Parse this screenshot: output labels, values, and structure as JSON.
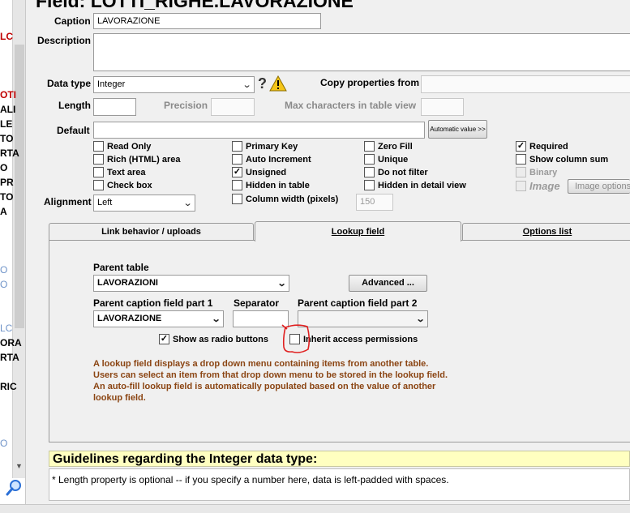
{
  "window_title": "Field: LOTTI_RIGHE.LAVORAZIONE",
  "left_panel": {
    "fragments": [
      "LC",
      "",
      "OTI",
      "ALI",
      "LE",
      "TO",
      "RTA",
      "O",
      "PR",
      "TO",
      "A",
      "O",
      "O",
      "LC",
      "ORA",
      "RTA",
      "RIC",
      "O"
    ]
  },
  "form": {
    "caption_label": "Caption",
    "caption_value": "LAVORAZIONE",
    "description_label": "Description",
    "data_type_label": "Data type",
    "data_type_value": "Integer",
    "copy_properties_label": "Copy properties from",
    "length_label": "Length",
    "precision_label": "Precision",
    "max_chars_label": "Max characters in table view",
    "default_label": "Default",
    "automatic_value_button": "Automatic value >>",
    "alignment_label": "Alignment",
    "alignment_value": "Left",
    "column_width_value": "150"
  },
  "checkboxes": {
    "read_only": {
      "label": "Read Only",
      "checked": false
    },
    "rich_html": {
      "label": "Rich (HTML) area",
      "checked": false
    },
    "text_area": {
      "label": "Text area",
      "checked": false
    },
    "check_box": {
      "label": "Check box",
      "checked": false
    },
    "primary_key": {
      "label": "Primary Key",
      "checked": false
    },
    "auto_increment": {
      "label": "Auto Increment",
      "checked": false
    },
    "unsigned": {
      "label": "Unsigned",
      "checked": true
    },
    "hidden_in_table": {
      "label": "Hidden in table",
      "checked": false
    },
    "column_width": {
      "label": "Column width (pixels)",
      "checked": false
    },
    "zero_fill": {
      "label": "Zero Fill",
      "checked": false
    },
    "unique": {
      "label": "Unique",
      "checked": false
    },
    "do_not_filter": {
      "label": "Do not filter",
      "checked": false
    },
    "hidden_in_detail": {
      "label": "Hidden in detail view",
      "checked": false
    },
    "required": {
      "label": "Required",
      "checked": true
    },
    "show_column_sum": {
      "label": "Show column sum",
      "checked": false
    },
    "binary": {
      "label": "Binary",
      "checked": false
    },
    "image": {
      "label": "Image",
      "checked": false
    }
  },
  "image_options_button": "Image options",
  "tabs": [
    {
      "label": "Link behavior / uploads"
    },
    {
      "label": "Lookup field"
    },
    {
      "label": "Options list"
    }
  ],
  "lookup": {
    "parent_table_label": "Parent table",
    "parent_table_value": "LAVORAZIONI",
    "advanced_button": "Advanced ...",
    "caption_part1_label": "Parent caption field part 1",
    "caption_part1_value": "LAVORAZIONE",
    "separator_label": "Separator",
    "caption_part2_label": "Parent caption field part 2",
    "show_radio": {
      "label": "Show as radio buttons",
      "checked": true
    },
    "inherit_access": {
      "label": "Inherit access permissions",
      "checked": false
    },
    "note": "A lookup field displays a drop down menu containing items from another table. Users can select an item from that drop down menu to be stored in the lookup field. An auto-fill lookup field is automatically populated based on the value of another lookup field."
  },
  "guidelines": {
    "heading": "Guidelines regarding the Integer data type:",
    "text": "* Length property is optional -- if you specify a number here, data is left-padded with spaces."
  },
  "colors": {
    "note_text": "#8b4513",
    "guidelines_bg": "#ffffc0",
    "annotation": "#e02020"
  }
}
